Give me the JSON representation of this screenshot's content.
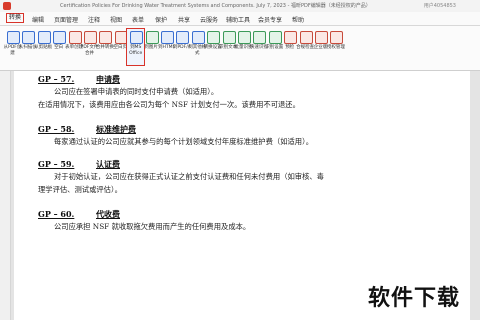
{
  "titlebar": {
    "title": "Certification Policies For Drinking Water Treatment Systems and Components. July 7, 2023 - 福昕PDF编辑器（未经授权的产品）",
    "user": "用户4054853"
  },
  "menu": [
    "转换",
    "编辑",
    "页面管理",
    "注释",
    "视图",
    "表单",
    "保护",
    "共享",
    "云服务",
    "辅助工具",
    "会员专享",
    "帮助"
  ],
  "tools": [
    {
      "label": "从PDF创建",
      "color": "blue"
    },
    {
      "label": "从扫描仪",
      "color": "blue"
    },
    {
      "label": "从剪贴板",
      "color": "blue"
    },
    {
      "label": "空白",
      "color": "blue"
    },
    {
      "label": "表单创建",
      "color": "red"
    },
    {
      "label": "PDF文件合并",
      "color": "red"
    },
    {
      "label": "合并转换",
      "color": "red"
    },
    {
      "label": "空白页",
      "color": "red"
    },
    {
      "label": "到MS Office",
      "color": "blue"
    },
    {
      "label": "到图片",
      "color": "green"
    },
    {
      "label": "到HTML",
      "color": "blue"
    },
    {
      "label": "到PDF/A",
      "color": "blue"
    },
    {
      "label": "到其他格式",
      "color": "blue"
    },
    {
      "label": "转换设置",
      "color": "green"
    },
    {
      "label": "识别文本",
      "color": "green"
    },
    {
      "label": "批量识别",
      "color": "green"
    },
    {
      "label": "快速识别",
      "color": "green"
    },
    {
      "label": "识别设置",
      "color": "green"
    },
    {
      "label": "预检",
      "color": "red"
    },
    {
      "label": "合规检查",
      "color": "red"
    },
    {
      "label": "企业版",
      "color": "red"
    },
    {
      "label": "授权管理",
      "color": "red"
    }
  ],
  "sections": [
    {
      "code": "GP – 57.",
      "title": "申请费",
      "lines": [
        "公司应在签署申请表的同时支付申请费（如适用）。",
        "在适用情况下，该费用应由各公司为每个 NSF 计划支付一次。该费用不可退还。"
      ]
    },
    {
      "code": "GP – 58.",
      "title": "标准维护费",
      "lines": [
        "每家通过认证的公司应就其参与的每个计划领域支付年度标准维护费（如适用）。"
      ]
    },
    {
      "code": "GP – 59.",
      "title": "认证费",
      "lines": [
        "对于初始认证，公司应在获得正式认证之前支付认证费和任何未付费用（如审核、毒",
        "理学评估、测试或评估）。"
      ]
    },
    {
      "code": "GP – 60.",
      "title": "代收费",
      "lines": [
        "公司应承担 NSF 就收取拖欠费用而产生的任何费用及成本。"
      ]
    }
  ],
  "watermark": "软件下载"
}
